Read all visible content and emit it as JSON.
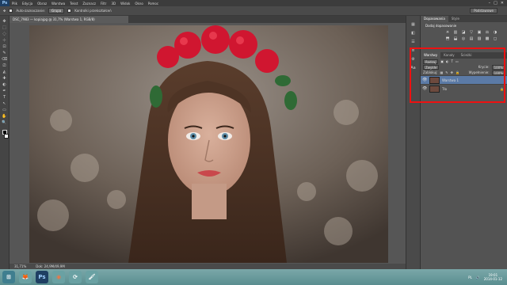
{
  "menubar": {
    "logo": "Ps",
    "items": [
      "Plik",
      "Edycja",
      "Obraz",
      "Warstwa",
      "Tekst",
      "Zaznacz",
      "Filtr",
      "3D",
      "Widok",
      "Okno",
      "Pomoc"
    ],
    "win_controls": [
      "–",
      "□",
      "✕"
    ]
  },
  "options": {
    "autoselect_label": "Auto-zaznaczanie:",
    "autoselect_value": "Grupa",
    "transform_label": "Kontrolki przekształceń",
    "workspace": "Podstawowe"
  },
  "document": {
    "tab_title": "DSC_7983 — kopiajpg @ 31,7% (Warstwa 1, RGB/8)",
    "zoom": "31,71%",
    "doc_size": "Dok: 24,9M/49,9M"
  },
  "tools": [
    "✥",
    "⬚",
    "◌",
    "⊹",
    "⊡",
    "✎",
    "⌫",
    "⎚",
    "◭",
    "✚",
    "◐",
    "✒",
    "T",
    "↖",
    "▭",
    "✋",
    "🔍"
  ],
  "mid_icons": [
    "▦",
    "◧",
    "☰",
    "≡",
    "⚙",
    "Aa"
  ],
  "panel_top": {
    "tabs": [
      "Dopasowania",
      "Style"
    ],
    "title": "Dodaj dopasowanie",
    "buttons": [
      "☀",
      "▥",
      "◪",
      "▽",
      "▣",
      "⚖",
      "◑",
      "⬒",
      "⬓",
      "◎",
      "▤",
      "▨",
      "▩",
      "◻"
    ]
  },
  "layers": {
    "tabs": [
      "Warstwy",
      "Kanały",
      "Ścieżki"
    ],
    "filter_kind": "Rodzaj",
    "blend_mode": "Zwykłe",
    "opacity_label": "Krycie:",
    "opacity_value": "100%",
    "lock_label": "Zablokuj:",
    "fill_label": "Wypełnienie:",
    "fill_value": "100%",
    "items": [
      {
        "name": "Warstwa 1",
        "selected": true
      },
      {
        "name": "Tło",
        "selected": false,
        "locked": true
      }
    ],
    "lock_icon": "🔒"
  },
  "taskbar": {
    "apps": [
      "⊞",
      "🦊",
      "Ps",
      "◉",
      "⟳",
      "🖌"
    ],
    "language": "PL",
    "time": "19:01",
    "date": "2014-01-12"
  },
  "colors": {
    "accent": "#5b7aa6",
    "highlight_box": "#e11111",
    "ps_blue": "#1f3f63"
  }
}
